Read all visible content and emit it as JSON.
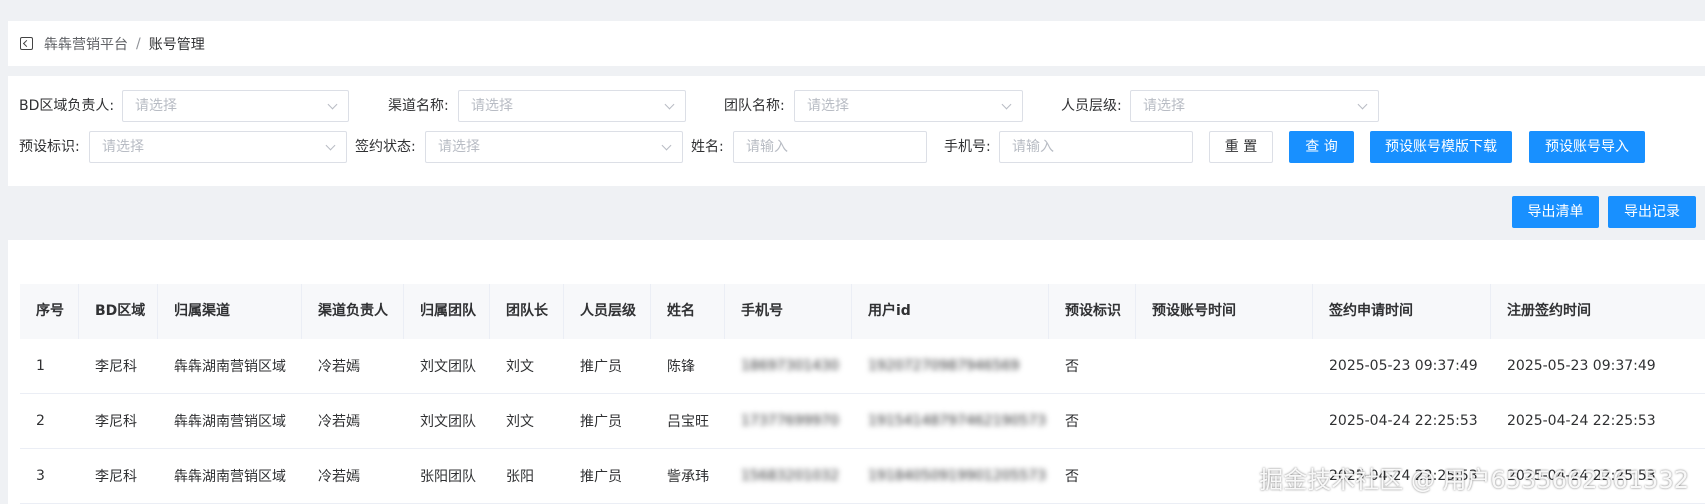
{
  "breadcrumb": {
    "root": "犇犇营销平台",
    "separator": "/",
    "current": "账号管理"
  },
  "filters": {
    "bd_owner": {
      "label": "BD区域负责人:",
      "placeholder": "请选择"
    },
    "channel": {
      "label": "渠道名称:",
      "placeholder": "请选择"
    },
    "team": {
      "label": "团队名称:",
      "placeholder": "请选择"
    },
    "level": {
      "label": "人员层级:",
      "placeholder": "请选择"
    },
    "preset": {
      "label": "预设标识:",
      "placeholder": "请选择"
    },
    "sign_status": {
      "label": "签约状态:",
      "placeholder": "请选择"
    },
    "name": {
      "label": "姓名:",
      "placeholder": "请输入"
    },
    "phone": {
      "label": "手机号:",
      "placeholder": "请输入"
    }
  },
  "buttons": {
    "reset": "重 置",
    "query": "查 询",
    "template_download": "预设账号模版下载",
    "import": "预设账号导入",
    "export_list": "导出清单",
    "export_record": "导出记录"
  },
  "table": {
    "headers": [
      "序号",
      "BD区域",
      "归属渠道",
      "渠道负责人",
      "归属团队",
      "团队长",
      "人员层级",
      "姓名",
      "手机号",
      "用户id",
      "预设标识",
      "预设账号时间",
      "签约申请时间",
      "注册签约时间"
    ],
    "rows": [
      [
        "1",
        "李尼科",
        "犇犇湖南营销区域",
        "冷若嫣",
        "刘文团队",
        "刘文",
        "推广员",
        "陈锋",
        "18697301430",
        "19207270987946569",
        "否",
        "",
        "2025-05-23 09:37:49",
        "2025-05-23 09:37:49"
      ],
      [
        "2",
        "李尼科",
        "犇犇湖南营销区域",
        "冷若嫣",
        "刘文团队",
        "刘文",
        "推广员",
        "吕宝旺",
        "17377699970",
        "19154148797462190573",
        "否",
        "",
        "2025-04-24 22:25:53",
        "2025-04-24 22:25:53"
      ],
      [
        "3",
        "李尼科",
        "犇犇湖南营销区域",
        "冷若嫣",
        "张阳团队",
        "张阳",
        "推广员",
        "訾承玮",
        "15683201032",
        "19184050919901205573",
        "否",
        "",
        "2025-04-24 22:25:53",
        "2025-04-24 22:25:53"
      ]
    ]
  },
  "watermark": "掘金技术社区 @ 用户6535662561532"
}
